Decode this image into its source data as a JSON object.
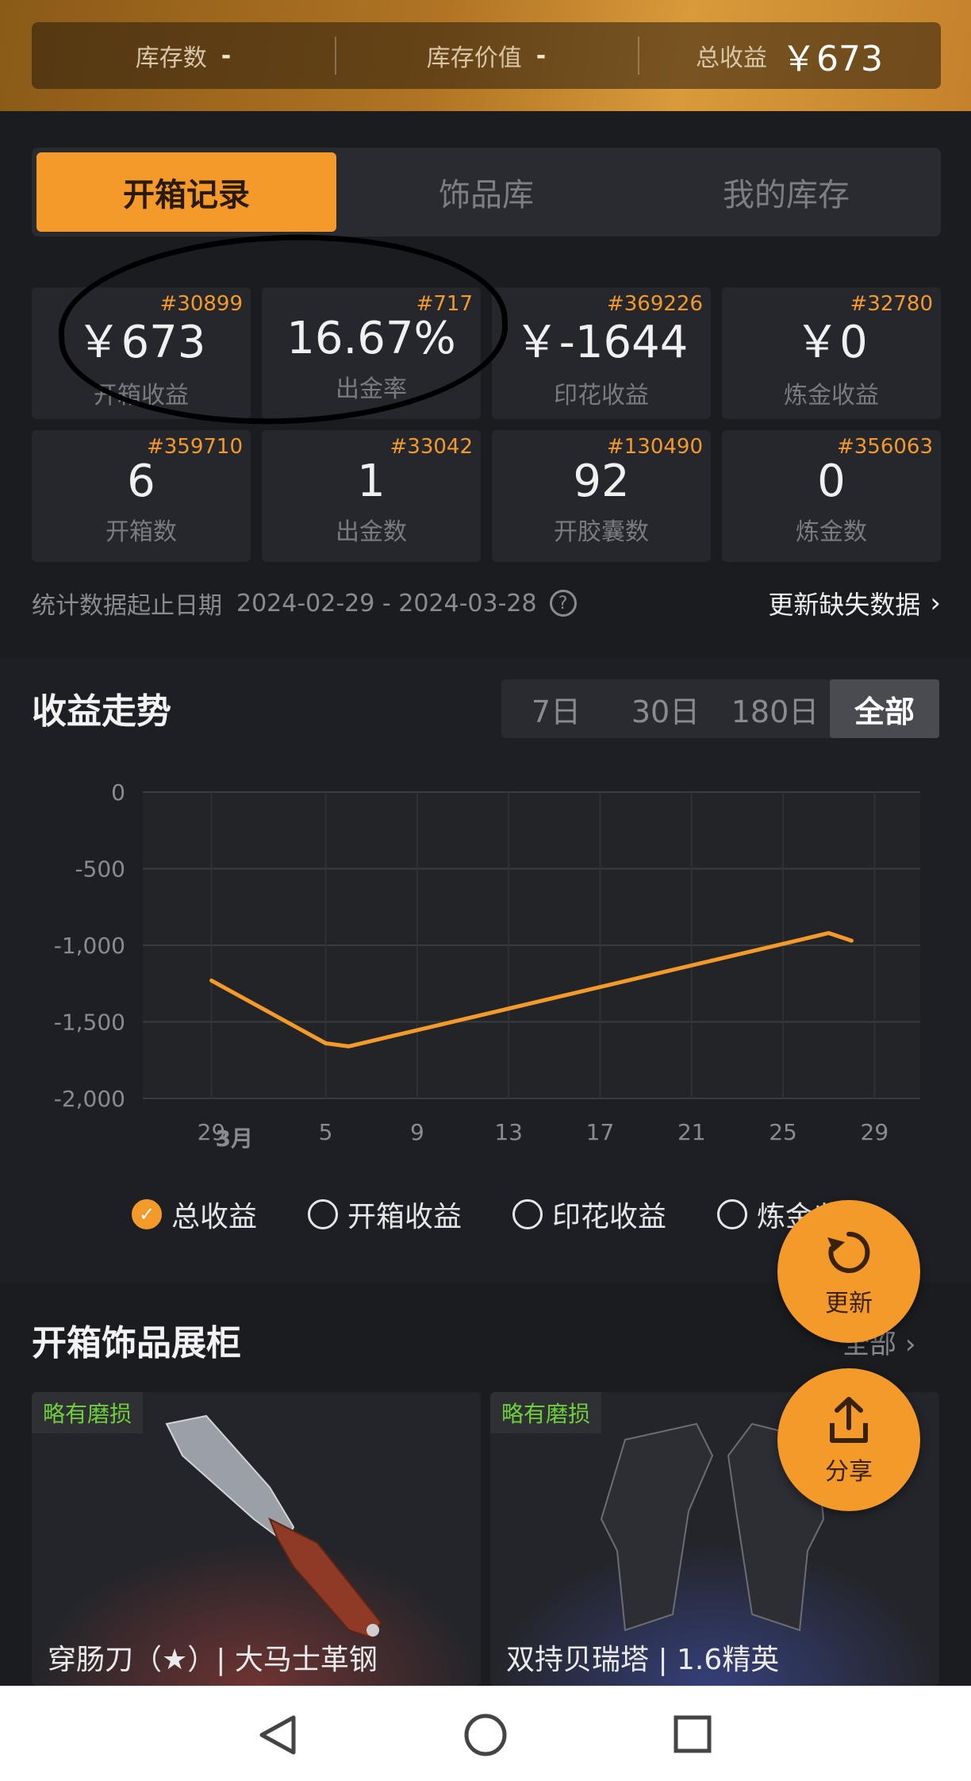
{
  "topbar": {
    "stock_count_label": "库存数",
    "stock_count_value": "-",
    "stock_value_label": "库存价值",
    "stock_value_value": "-",
    "total_profit_label": "总收益",
    "total_profit_value": "￥673"
  },
  "tabs": [
    "开箱记录",
    "饰品库",
    "我的库存"
  ],
  "stats": [
    {
      "rank": "#30899",
      "value": "￥673",
      "label": "开箱收益"
    },
    {
      "rank": "#717",
      "value": "16.67%",
      "label": "出金率"
    },
    {
      "rank": "#369226",
      "value": "￥-1644",
      "label": "印花收益"
    },
    {
      "rank": "#32780",
      "value": "￥0",
      "label": "炼金收益"
    },
    {
      "rank": "#359710",
      "value": "6",
      "label": "开箱数"
    },
    {
      "rank": "#33042",
      "value": "1",
      "label": "出金数"
    },
    {
      "rank": "#130490",
      "value": "92",
      "label": "开胶囊数"
    },
    {
      "rank": "#356063",
      "value": "0",
      "label": "炼金数"
    }
  ],
  "date_range": {
    "label": "统计数据起止日期",
    "value": "2024-02-29 - 2024-03-28",
    "update_link": "更新缺失数据"
  },
  "trend": {
    "title": "收益走势",
    "ranges": [
      "7日",
      "30日",
      "180日",
      "全部"
    ],
    "active_range": "全部"
  },
  "chart_data": {
    "type": "line",
    "series": [
      {
        "name": "总收益",
        "color": "#f39a2a",
        "x": [
          "2024-02-29",
          "2024-03-05",
          "2024-03-06",
          "2024-03-27",
          "2024-03-28"
        ],
        "y": [
          -1230,
          -1640,
          -1660,
          -920,
          -970
        ]
      }
    ],
    "x_ticks": [
      "29",
      "3月",
      "5",
      "9",
      "13",
      "17",
      "21",
      "25",
      "29"
    ],
    "y_ticks": [
      "0",
      "-500",
      "-1,000",
      "-1,500",
      "-2,000"
    ],
    "ylim": [
      -2000,
      0
    ]
  },
  "legend": [
    {
      "label": "总收益",
      "checked": true
    },
    {
      "label": "开箱收益",
      "checked": false
    },
    {
      "label": "印花收益",
      "checked": false
    },
    {
      "label": "炼金收益",
      "checked": false
    }
  ],
  "showcase": {
    "title": "开箱饰品展柜",
    "all_link": "全部",
    "cards": [
      {
        "badge": "略有磨损",
        "name": "穿肠刀（★）| 大马士革钢"
      },
      {
        "badge": "略有磨损",
        "name": "双持贝瑞塔 | 1.6精英"
      }
    ]
  },
  "fab": {
    "refresh": "更新",
    "share": "分享"
  }
}
